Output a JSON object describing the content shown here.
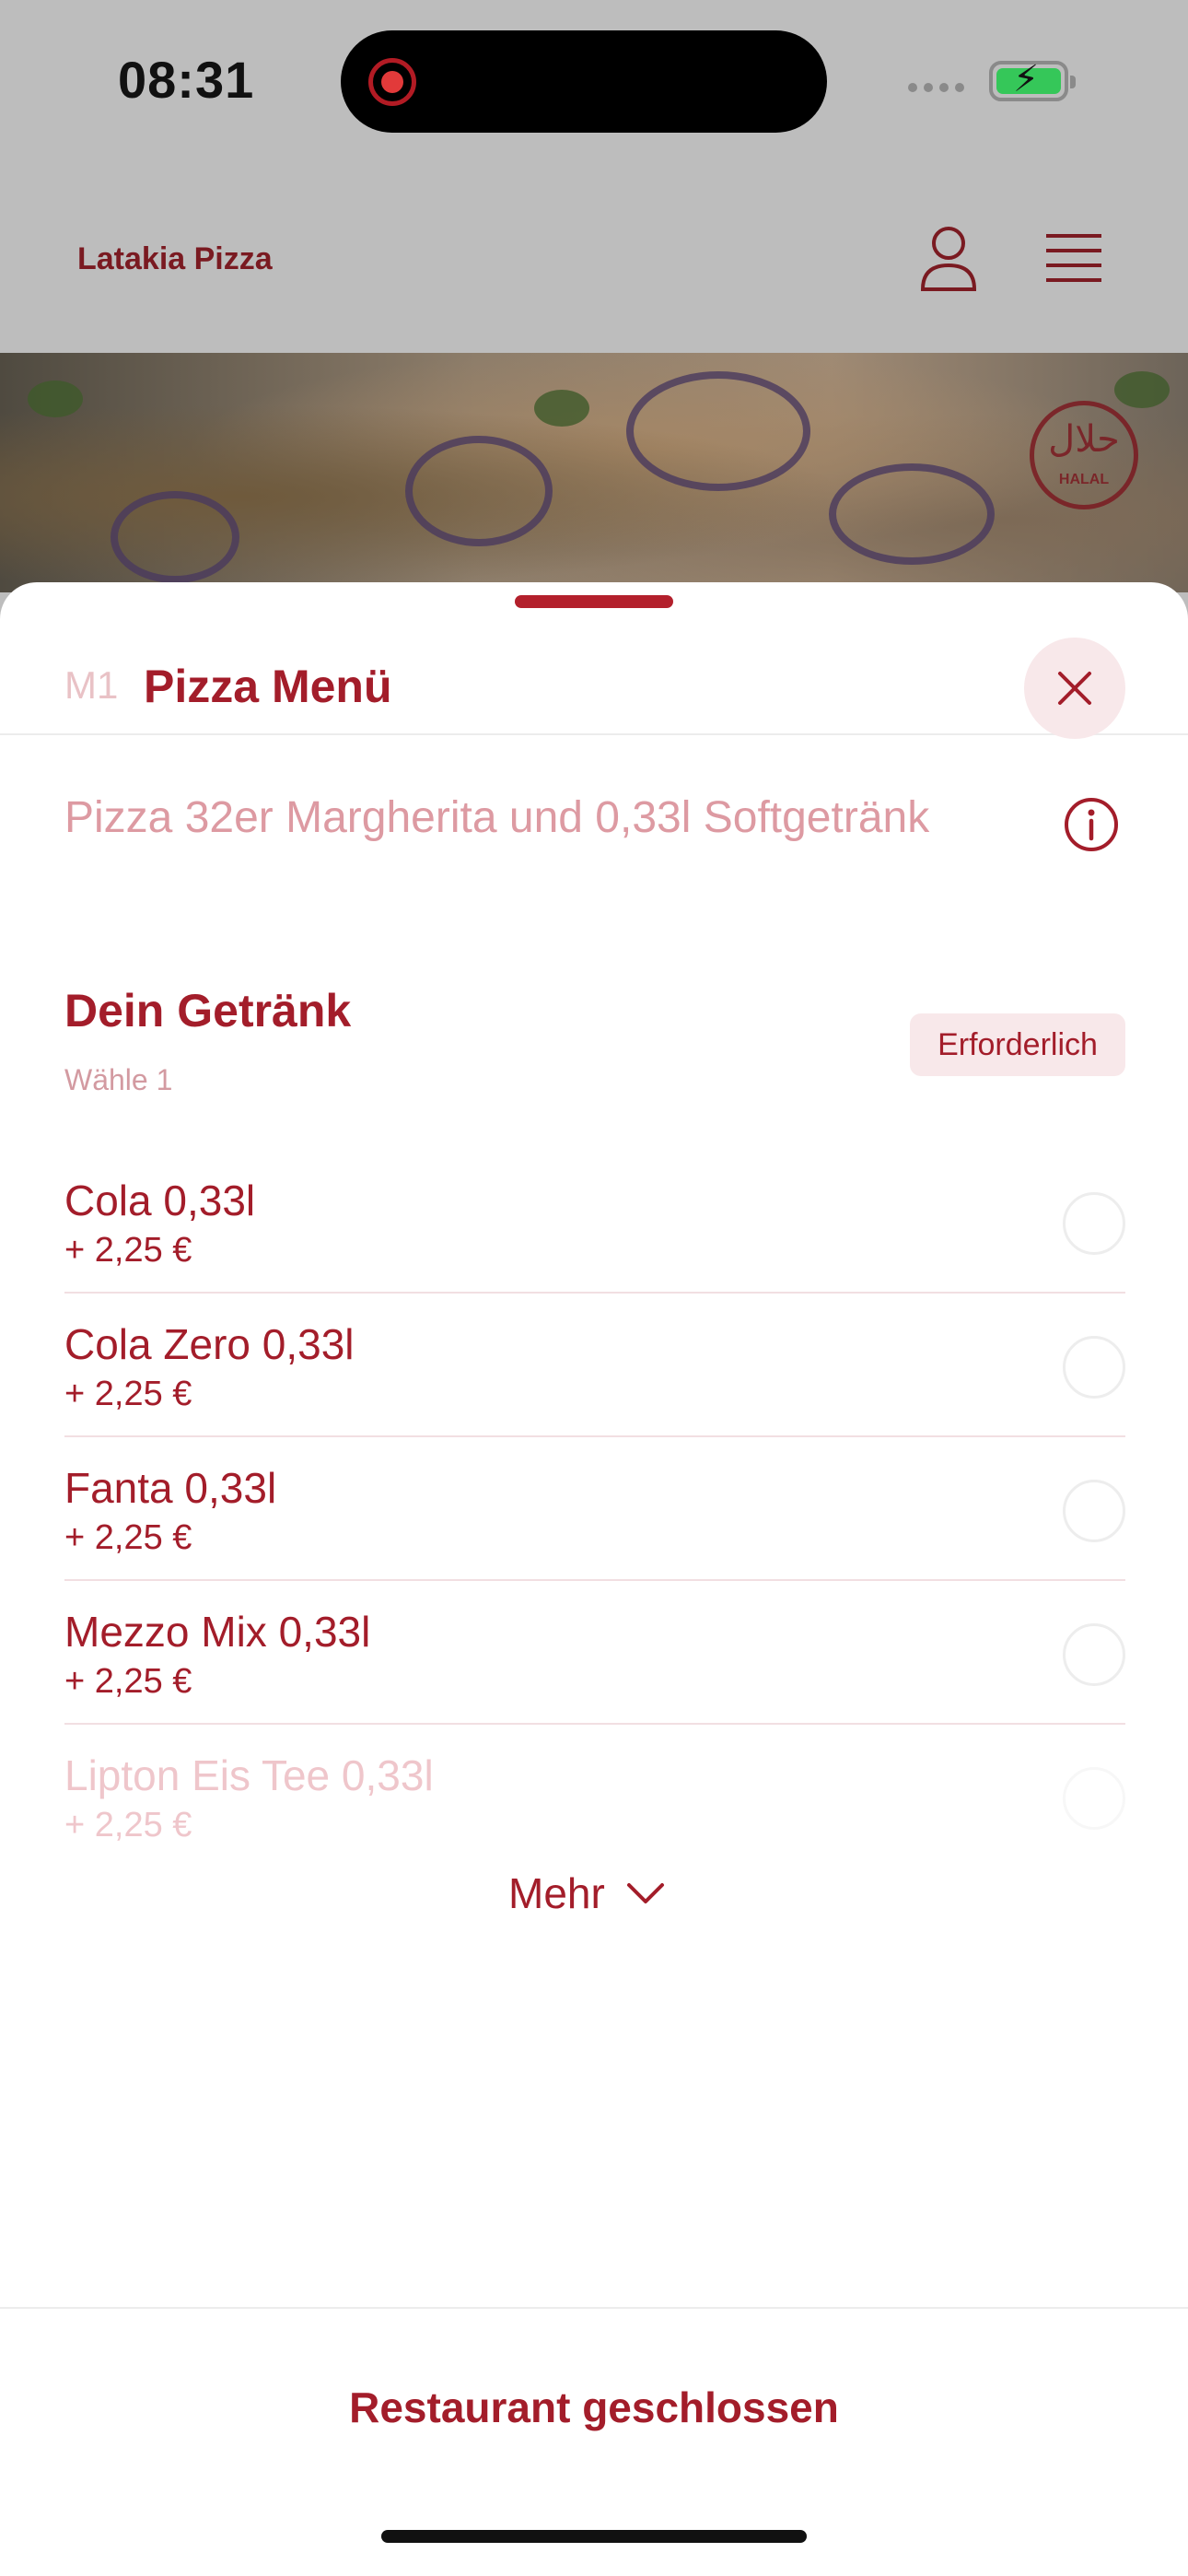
{
  "status_bar": {
    "time": "08:31"
  },
  "app_header": {
    "brand": "Latakia Pizza",
    "halal_arabic": "حلال",
    "halal_latin": "HALAL"
  },
  "sheet": {
    "item_code": "M1",
    "item_title": "Pizza Menü",
    "description": "Pizza 32er Margherita und 0,33l Softgetränk",
    "section": {
      "title": "Dein Getränk",
      "subtitle": "Wähle 1",
      "badge": "Erforderlich"
    },
    "options": [
      {
        "name": "Cola 0,33l",
        "price": "+ 2,25 €"
      },
      {
        "name": "Cola Zero 0,33l",
        "price": "+ 2,25 €"
      },
      {
        "name": "Fanta 0,33l",
        "price": "+ 2,25 €"
      },
      {
        "name": "Mezzo Mix 0,33l",
        "price": "+ 2,25 €"
      },
      {
        "name": "Lipton Eis Tee 0,33l",
        "price": "+ 2,25 €"
      }
    ],
    "more_label": "Mehr",
    "footer_label": "Restaurant geschlossen"
  },
  "colors": {
    "accent": "#a31d2a",
    "badge_bg": "#f8e8ea",
    "overlay": "#bdbdbd"
  },
  "icons": [
    "record-icon",
    "signal-icon",
    "battery-icon",
    "profile-icon",
    "hamburger-menu-icon",
    "close-icon",
    "info-icon",
    "chevron-down-icon"
  ]
}
